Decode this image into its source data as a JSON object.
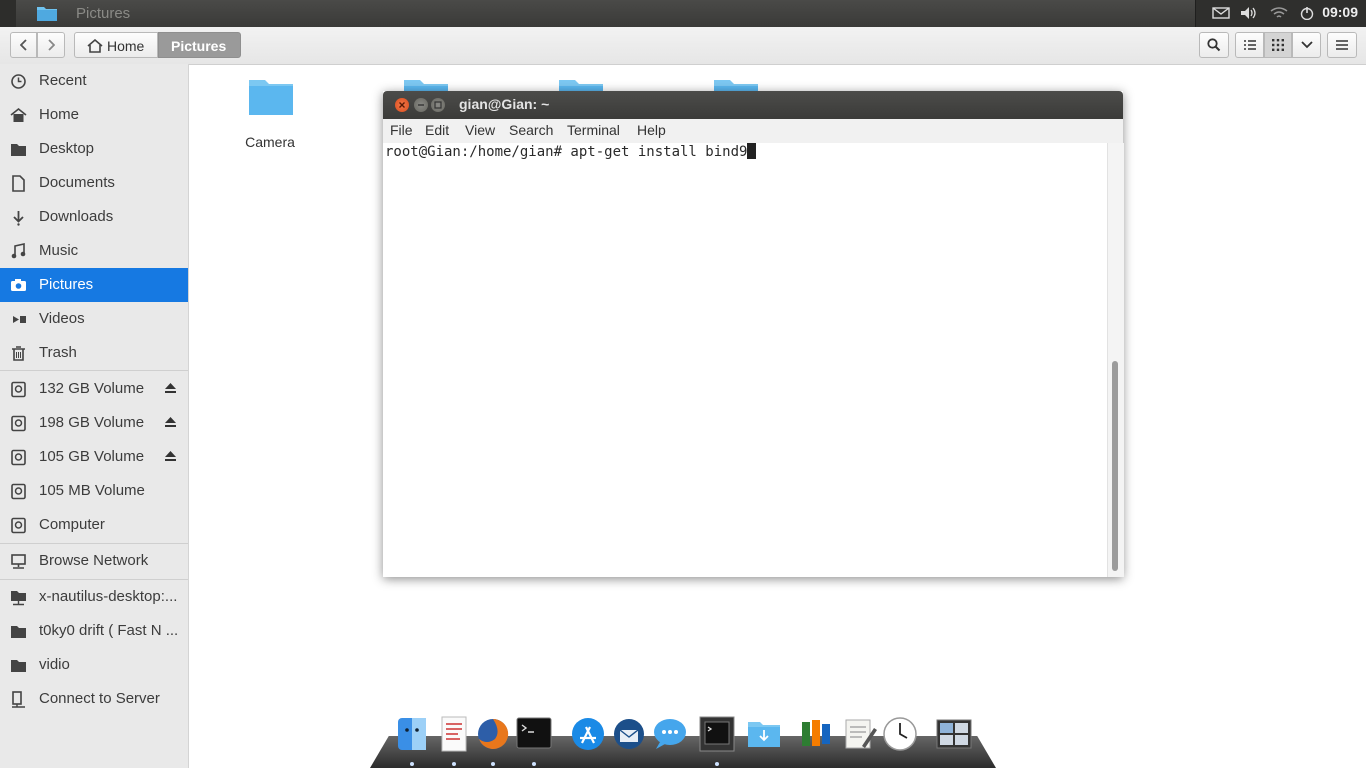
{
  "top_panel": {
    "window_title": "Pictures",
    "clock": "09:09",
    "tray_icons": [
      "mail-icon",
      "volume-icon",
      "wifi-icon",
      "power-icon"
    ]
  },
  "headerbar": {
    "path": [
      {
        "label": "Home",
        "icon": "home-icon"
      },
      {
        "label": "Pictures"
      }
    ],
    "buttons": [
      "back",
      "forward",
      "search",
      "list-view",
      "grid-view",
      "view-options",
      "menu"
    ]
  },
  "sidebar": {
    "places": [
      {
        "label": "Recent",
        "icon": "clock-icon"
      },
      {
        "label": "Home",
        "icon": "home-icon"
      },
      {
        "label": "Desktop",
        "icon": "folder-icon"
      },
      {
        "label": "Documents",
        "icon": "document-icon"
      },
      {
        "label": "Downloads",
        "icon": "download-icon"
      },
      {
        "label": "Music",
        "icon": "music-icon"
      },
      {
        "label": "Pictures",
        "icon": "camera-icon",
        "active": true
      },
      {
        "label": "Videos",
        "icon": "video-icon"
      },
      {
        "label": "Trash",
        "icon": "trash-icon"
      }
    ],
    "devices": [
      {
        "label": "132 GB Volume",
        "eject": true
      },
      {
        "label": "198 GB Volume",
        "eject": true
      },
      {
        "label": "105 GB Volume",
        "eject": true
      },
      {
        "label": "105 MB Volume",
        "eject": false
      },
      {
        "label": "Computer",
        "eject": false
      }
    ],
    "network": [
      {
        "label": "Browse Network"
      }
    ],
    "bookmarks": [
      {
        "label": "x-nautilus-desktop:..."
      },
      {
        "label": "t0ky0 drift ( Fast N ..."
      },
      {
        "label": "vidio"
      },
      {
        "label": "Connect to Server"
      }
    ]
  },
  "content": {
    "folders": [
      {
        "label": "Camera"
      },
      {
        "label": ""
      },
      {
        "label": ""
      },
      {
        "label": ""
      }
    ]
  },
  "terminal": {
    "title": "gian@Gian: ~",
    "menu": [
      "File",
      "Edit",
      "View",
      "Search",
      "Terminal",
      "Help"
    ],
    "prompt_line": "root@Gian:/home/gian# apt-get install bind9"
  },
  "dock": {
    "apps": [
      "finder-icon",
      "text-editor-icon",
      "firefox-icon",
      "terminal-icon",
      "app-store-icon",
      "thunderbird-icon",
      "messages-icon",
      "active-terminal-icon",
      "downloads-folder-icon",
      "network-app-icon",
      "notes-icon",
      "clock-icon",
      "workspace-switcher-icon"
    ]
  },
  "colors": {
    "accent": "#1679e2",
    "folder": "#5bb7ef",
    "close": "#e05a2b"
  }
}
